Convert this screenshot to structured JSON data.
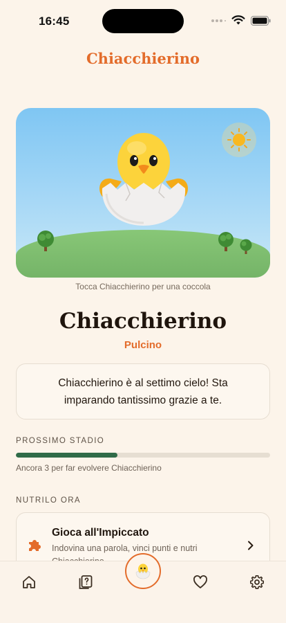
{
  "status_bar": {
    "time": "16:45"
  },
  "header": {
    "title": "Chiacchierino"
  },
  "hero": {
    "hint": "Tocca Chiacchierino per una coccola"
  },
  "pet": {
    "name": "Chiacchierino",
    "stage": "Pulcino"
  },
  "message": {
    "text": "Chiacchierino è al settimo cielo! Sta imparando tantissimo grazie a te."
  },
  "progress": {
    "label": "PROSSIMO STADIO",
    "fraction": 0.4,
    "caption": "Ancora 3 per far evolvere Chiacchierino"
  },
  "feed": {
    "label": "NUTRILO ORA",
    "card": {
      "title": "Gioca all'Impiccato",
      "description": "Indovina una parola, vinci punti e nutri Chiacchierino"
    }
  },
  "tab_bar": {
    "items": [
      "home-icon",
      "quiz-cards-icon",
      "hatching-chick-icon",
      "heart-icon",
      "gear-icon"
    ]
  },
  "colors": {
    "accent": "#e36c2b",
    "progress": "#2f6b48",
    "background": "#fcf4ea"
  }
}
